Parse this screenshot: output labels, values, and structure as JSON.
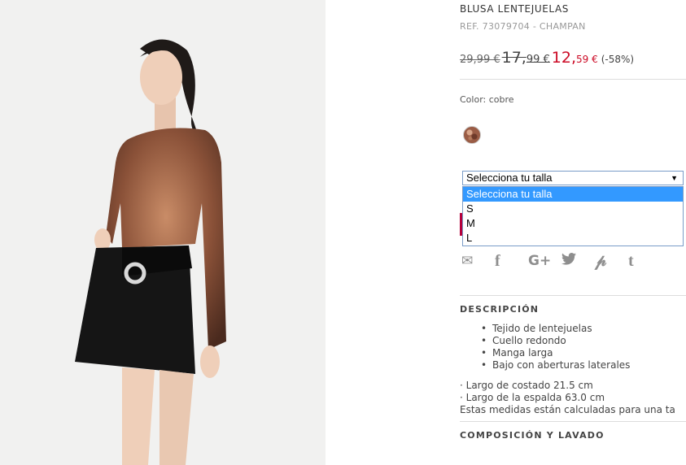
{
  "product": {
    "title": "BLUSA LENTEJUELAS",
    "ref": "REF. 73079704 - CHAMPAN",
    "price_old_1": "29,99 €",
    "price_old_2_int": "17,",
    "price_old_2_dec": "99 €",
    "price_new_int": "12,",
    "price_new_dec": "59 €",
    "discount": "(-58%)",
    "color_label": "Color: cobre"
  },
  "size_select": {
    "selected": "Selecciona tu talla",
    "options": [
      "Selecciona tu talla",
      "S",
      "M",
      "L"
    ]
  },
  "social": [
    "email-icon",
    "facebook-icon",
    "google-plus-icon",
    "twitter-icon",
    "pinterest-icon",
    "tumblr-icon"
  ],
  "social_glyphs": [
    "✉",
    "f",
    "G+",
    "🐦",
    "P",
    "t"
  ],
  "description": {
    "title": "DESCRIPCIÓN",
    "bullets": [
      "Tejido de lentejuelas",
      "Cuello redondo",
      "Manga larga",
      "Bajo con aberturas laterales"
    ],
    "measures": [
      "· Largo de costado 21.5 cm",
      "· Largo de la espalda 63.0 cm",
      "Estas medidas están calculadas para una ta"
    ]
  },
  "composition": {
    "title": "COMPOSICIÓN Y LAVADO"
  },
  "colors": {
    "price_sale": "#cc0a25",
    "select_highlight": "#3399ff"
  }
}
